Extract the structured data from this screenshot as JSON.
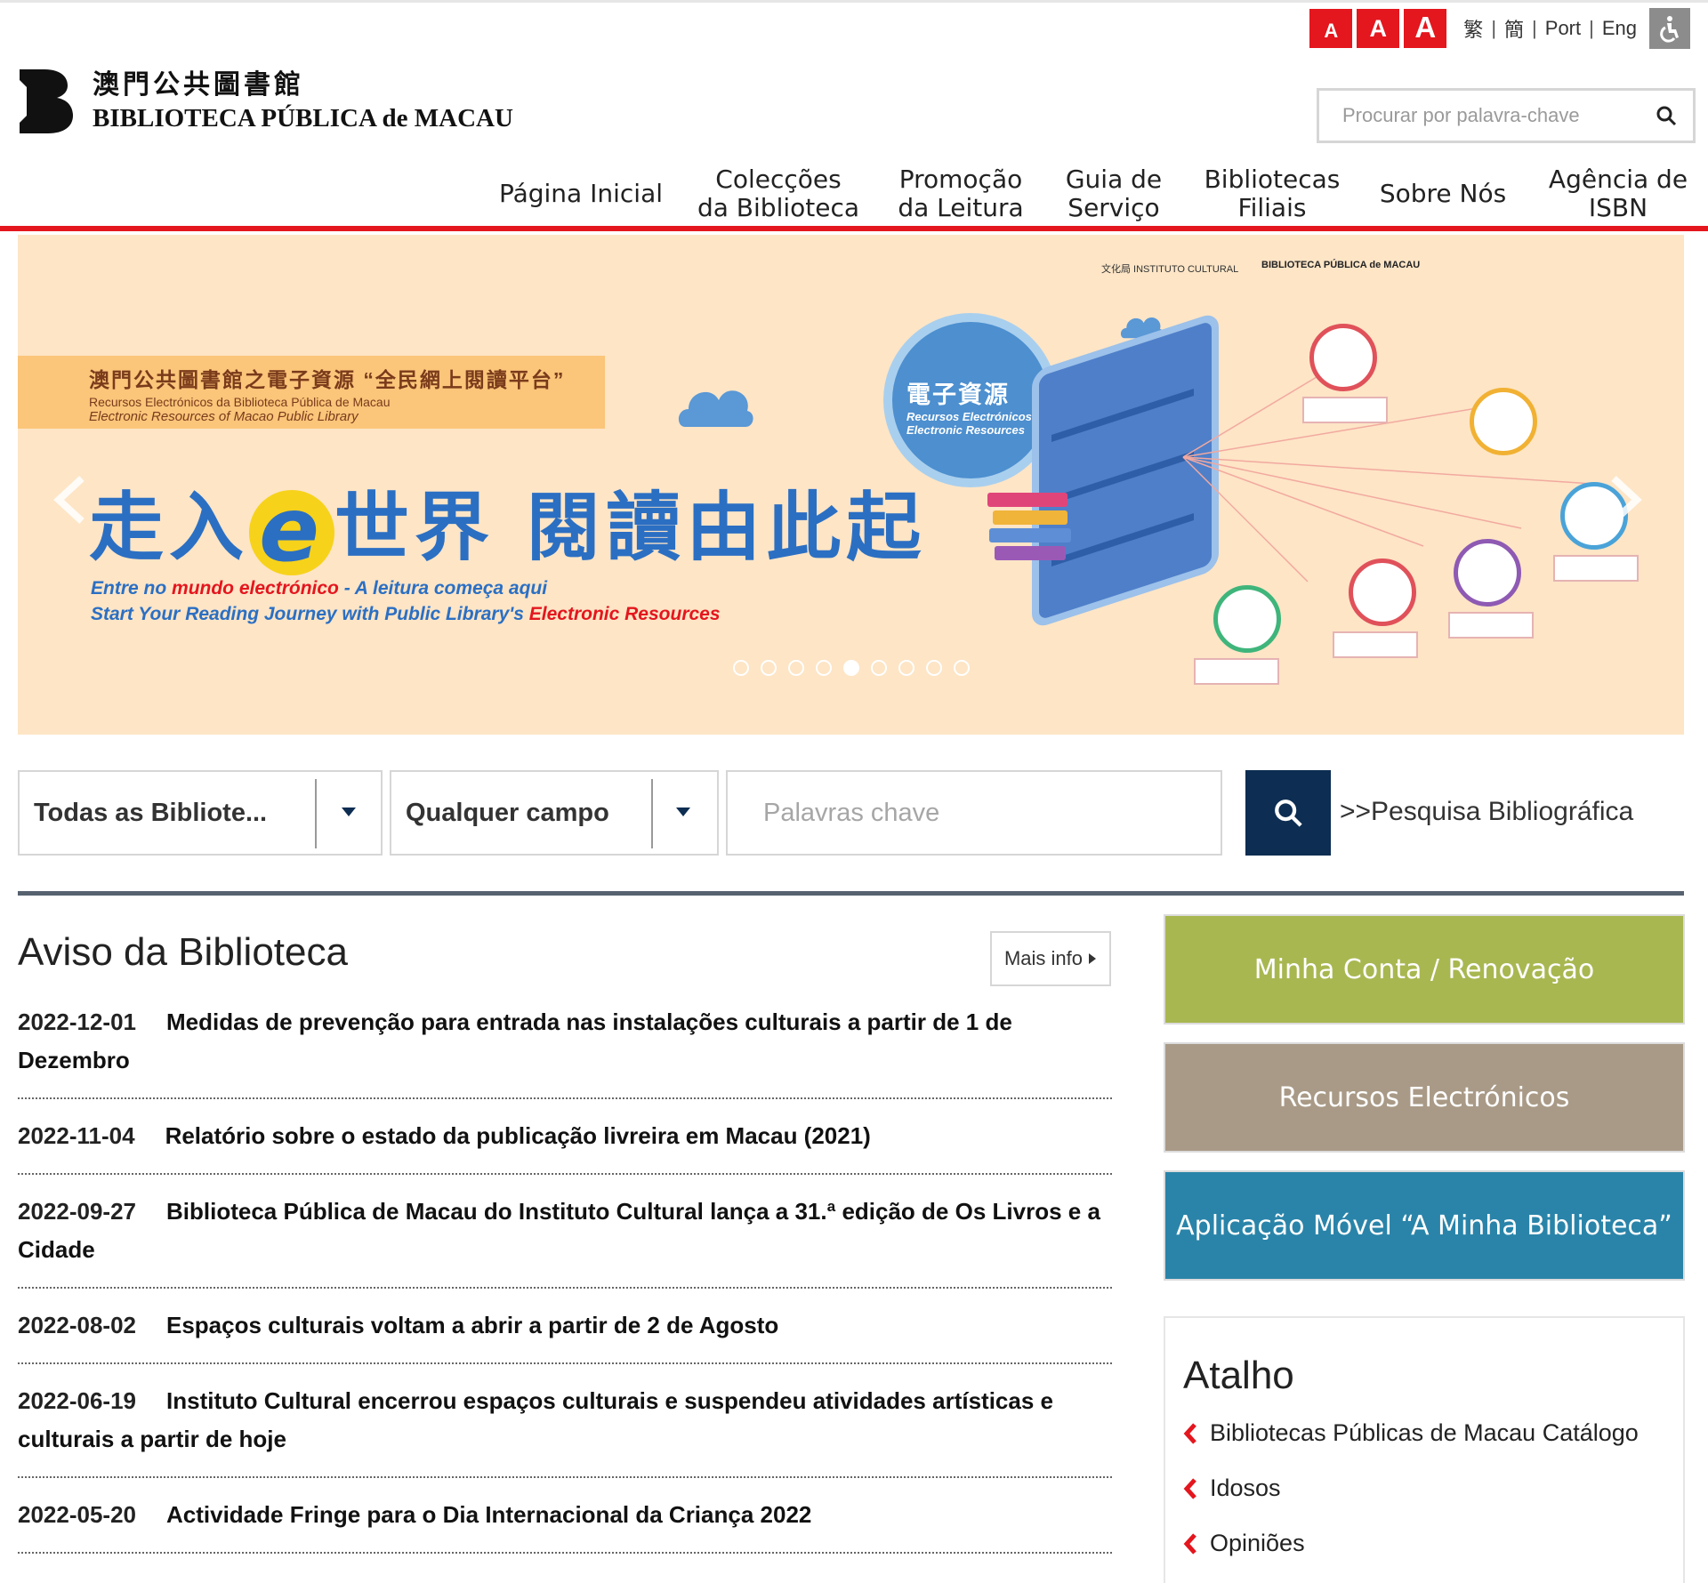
{
  "utility": {
    "font_buttons": [
      "A",
      "A",
      "A"
    ],
    "languages": [
      "繁",
      "簡",
      "Port",
      "Eng"
    ]
  },
  "logo": {
    "chinese": "澳門公共圖書館",
    "portuguese": "BIBLIOTECA PÚBLICA de MACAU"
  },
  "site_search": {
    "placeholder": "Procurar por palavra-chave"
  },
  "nav": [
    {
      "line1": "Página Inicial",
      "line2": ""
    },
    {
      "line1": "Colecções",
      "line2": "da Biblioteca"
    },
    {
      "line1": "Promoção",
      "line2": "da Leitura"
    },
    {
      "line1": "Guia de",
      "line2": "Serviço"
    },
    {
      "line1": "Bibliotecas",
      "line2": "Filiais"
    },
    {
      "line1": "Sobre Nós",
      "line2": ""
    },
    {
      "line1": "Agência de",
      "line2": "ISBN"
    }
  ],
  "banner": {
    "ribbon_cn": "澳門公共圖書館之電子資源 “全民網上閱讀平台”",
    "ribbon_pt": "Recursos Electrónicos da Biblioteca Pública de Macau",
    "ribbon_en": "Electronic Resources of Macao Public Library",
    "headline_a": "走入",
    "headline_e": "e",
    "headline_b": "世界 閱讀由此起",
    "sub_pt_a": "Entre no ",
    "sub_pt_hl": "mundo electrónico",
    "sub_pt_b": " - A leitura começa aqui",
    "sub_en_a": "Start Your Reading Journey with Public Library's ",
    "sub_en_hl": "Electronic Resources",
    "bubble_cn": "電子資源",
    "bubble_pt": "Recursos Electrónicos",
    "bubble_en": "Electronic Resources",
    "logo_ic": "文化局 INSTITUTO CULTURAL",
    "logo_bpm": "BIBLIOTECA PÚBLICA de MACAU",
    "slide_count": 9,
    "active_slide": 5
  },
  "catalog_search": {
    "library_select": "Todas as Bibliote...",
    "field_select": "Qualquer campo",
    "keyword_placeholder": "Palavras chave",
    "advanced_link": ">>Pesquisa Bibliográfica"
  },
  "notices": {
    "title": "Aviso da Biblioteca",
    "more": "Mais info",
    "items": [
      {
        "date": "2022-12-01",
        "title": "Medidas de prevenção para entrada nas instalações culturais a partir de 1 de Dezembro"
      },
      {
        "date": "2022-11-04",
        "title": "Relatório sobre o estado da publicação livreira em Macau (2021)"
      },
      {
        "date": "2022-09-27",
        "title": "Biblioteca Pública de Macau do Instituto Cultural lança a 31.ª edição de Os Livros e a Cidade"
      },
      {
        "date": "2022-08-02",
        "title": "Espaços culturais voltam a abrir a partir de 2 de Agosto"
      },
      {
        "date": "2022-06-19",
        "title": "Instituto Cultural encerrou espaços culturais e suspendeu atividades artísticas e culturais a partir de hoje"
      },
      {
        "date": "2022-05-20",
        "title": "Actividade Fringe para o Dia Internacional da Criança 2022"
      }
    ]
  },
  "tiles": {
    "account": "Minha Conta / Renovação",
    "eresources": "Recursos Electrónicos",
    "app": "Aplicação Móvel “A Minha Biblioteca”"
  },
  "atalho": {
    "title": "Atalho",
    "items": [
      "Bibliotecas Públicas de Macau Catálogo",
      "Idosos",
      "Opiniões"
    ]
  },
  "colors": {
    "brand_red": "#e4161e",
    "navy": "#0d2d52",
    "tile_green": "#a9b751",
    "tile_brown": "#a99a87",
    "tile_blue": "#2a84a9"
  }
}
